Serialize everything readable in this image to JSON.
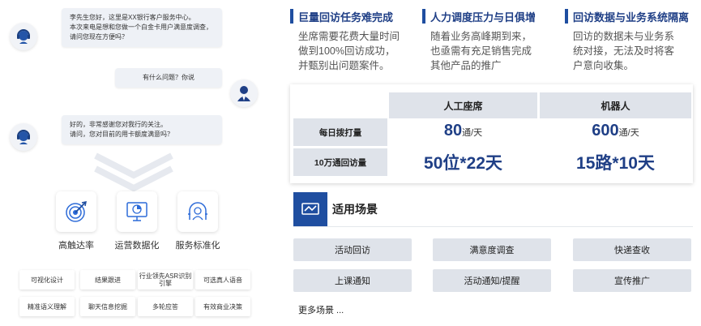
{
  "chat": {
    "msg1": [
      "李先生您好，这里是XX银行客户服务中心。",
      "本次来电是想和您做一个白金卡用户满意度调查，",
      "请问您现在方便吗？"
    ],
    "msg2": "有什么问题？你说",
    "msg3": [
      "好的，非常感谢您对我行的关注。",
      "请问，您对目前的用卡额度满意吗？"
    ]
  },
  "features": [
    {
      "label": "高触达率",
      "icon": "target-icon"
    },
    {
      "label": "运营数据化",
      "icon": "monitor-data-icon"
    },
    {
      "label": "服务标准化",
      "icon": "service-standard-icon"
    }
  ],
  "tags": [
    [
      "可视化设计",
      "结果跟进",
      "行业领先ASR识别引擎",
      "可选真人语音"
    ],
    [
      "精准语义理解",
      "聊天信息挖掘",
      "多轮应答",
      "有效商业决策"
    ]
  ],
  "pains": [
    {
      "title": "巨量回访任务难完成",
      "lines": [
        "坐席需要花费大量时间",
        "做到100%回访成功，",
        "并甄别出问题案件。"
      ]
    },
    {
      "title": "人力调度压力与日俱增",
      "lines": [
        "随着业务高峰期到来，",
        "也亟需有充足销售完成",
        "其他产品的推广"
      ]
    },
    {
      "title": "回访数据与业务系统隔离",
      "lines": [
        "回访的数据未与业务系",
        "统对接，无法及时将客",
        "户意向收集。"
      ]
    }
  ],
  "compare": {
    "col_human": "人工座席",
    "col_robot": "机器人",
    "row_daily": "每日拨打量",
    "row_10w": "10万通回访量",
    "human_daily": "80",
    "robot_daily": "600",
    "daily_unit": "通/天",
    "human_10w": "50位*22天",
    "robot_10w": "15路*10天"
  },
  "scenes": {
    "title": "适用场景",
    "items": [
      "活动回访",
      "满意度调查",
      "快递查收",
      "上课通知",
      "活动通知/提醒",
      "宣传推广"
    ],
    "more": "更多场景 ..."
  },
  "colors": {
    "accent": "#1f4ea0",
    "accent_text": "#1f3f86",
    "cell_bg": "#dfe3ea",
    "bubble_bg": "#eef1f6"
  }
}
